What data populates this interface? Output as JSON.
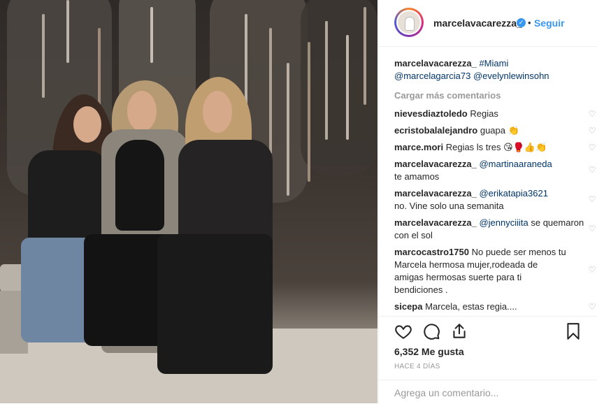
{
  "post": {
    "username": "marcelavacarezza_",
    "follow_label": "Seguir",
    "separator": "•",
    "verified_glyph": "✓"
  },
  "comments": {
    "caption": {
      "user": "marcelavacarezza_",
      "hashtag": "#Miami",
      "mention1": "@marcelagarcia73",
      "mention2": "@evelynlewinsohn"
    },
    "load_more": "Cargar más comentarios",
    "items": [
      {
        "user": "nievesdiaztoledo",
        "text": "Regias"
      },
      {
        "user": "ecristobalalejandro",
        "text": "guapa 👏"
      },
      {
        "user": "marce.mori",
        "text": "Regias ls tres 😘🥊👍👏"
      },
      {
        "user": "marcelavacarezza_",
        "mention": "@martinaaraneda",
        "text": "te amamos"
      },
      {
        "user": "marcelavacarezza_",
        "mention": "@erikatapia3621",
        "text": "no. Vine solo una semanita"
      },
      {
        "user": "marcelavacarezza_",
        "mention": "@jennyciiita",
        "text": "se quemaron con el sol"
      },
      {
        "user": "marcocastro1750",
        "text": "No puede ser menos tu Marcela hermosa mujer,rodeada de amigas hermosas suerte para ti bendiciones ."
      },
      {
        "user": "sicepa",
        "text": "Marcela, estas regia...."
      }
    ]
  },
  "actions": {
    "likes": "6,352 Me gusta",
    "time": "HACE 4 DÍAS"
  },
  "add_comment": {
    "placeholder": "Agrega un comentario..."
  },
  "icons": {
    "like": "heart-icon",
    "comment": "comment-icon",
    "share": "share-icon",
    "save": "bookmark-icon",
    "comment_like": "heart-outline-icon"
  },
  "colors": {
    "link": "#003569",
    "accent": "#3897f0",
    "muted": "#999999",
    "text": "#262626"
  }
}
